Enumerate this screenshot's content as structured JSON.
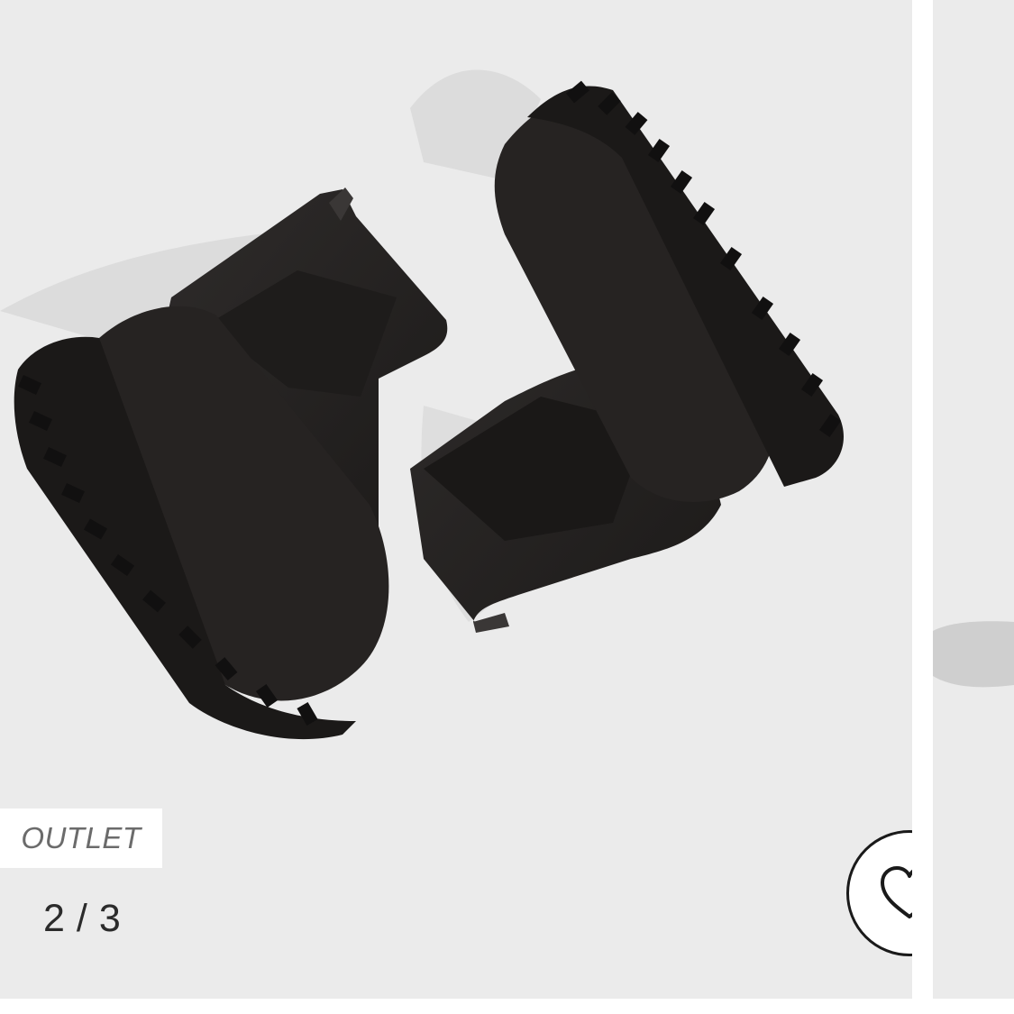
{
  "gallery": {
    "badge_label": "OUTLET",
    "counter": {
      "current": "2",
      "separator": "/",
      "total": "3"
    },
    "wishlist_icon": "heart-outline-icon",
    "image_subject": "black-chelsea-boots-icon"
  },
  "colors": {
    "background": "#ebebeb",
    "badge_text": "#6b6b6b",
    "counter_text": "#2b2b2b",
    "icon_stroke": "#1a1a1a"
  }
}
